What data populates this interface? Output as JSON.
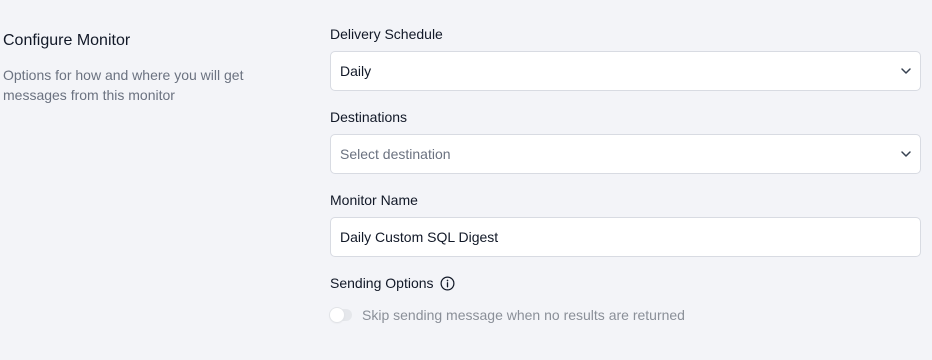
{
  "section": {
    "title": "Configure Monitor",
    "description": "Options for how and where you will get messages from this monitor"
  },
  "fields": {
    "delivery_schedule": {
      "label": "Delivery Schedule",
      "value": "Daily"
    },
    "destinations": {
      "label": "Destinations",
      "placeholder": "Select destination"
    },
    "monitor_name": {
      "label": "Monitor Name",
      "value": "Daily Custom SQL Digest"
    },
    "sending_options": {
      "label": "Sending Options",
      "toggle_label": "Skip sending message when no results are returned",
      "toggle_on": false
    }
  }
}
